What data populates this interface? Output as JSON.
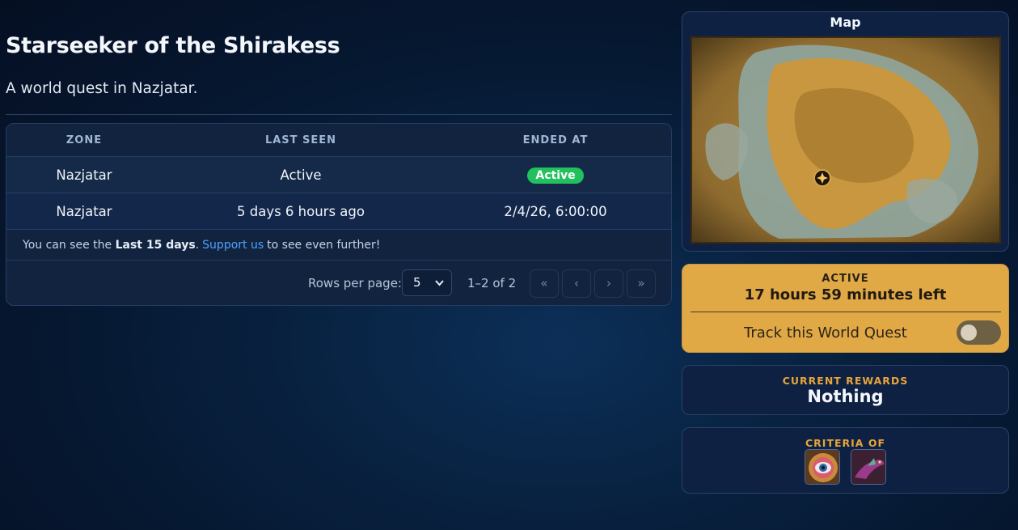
{
  "quest": {
    "title": "Starseeker of the Shirakess",
    "subtitle": "A world quest in Nazjatar."
  },
  "table": {
    "headers": [
      "ZONE",
      "LAST SEEN",
      "ENDED AT"
    ],
    "rows": [
      {
        "zone": "Nazjatar",
        "last_seen": "Active",
        "ended_at": "Active"
      },
      {
        "zone": "Nazjatar",
        "last_seen": "5 days 6 hours ago",
        "ended_at": "2/4/26, 6:00:00"
      }
    ],
    "note": {
      "prefix": "You can see the",
      "bold": "Last 15 days",
      "link": "Support us",
      "suffix": "to see even further!"
    },
    "pagination": {
      "rows_label": "Rows per page:",
      "rows_value": "5",
      "range": "1–2 of 2",
      "first": "«",
      "prev": "‹",
      "next": "›",
      "last": "»"
    }
  },
  "map": {
    "title": "Map",
    "marker_icon": "quest-marker-icon"
  },
  "status": {
    "label": "ACTIVE",
    "time_left": "17 hours 59 minutes left",
    "track_label": "Track this World Quest",
    "track_enabled": false
  },
  "rewards": {
    "label": "CURRENT REWARDS",
    "value": "Nothing"
  },
  "criteria": {
    "label": "CRITERIA OF",
    "icons": [
      "eye-achievement-icon",
      "eel-creature-icon"
    ]
  },
  "colors": {
    "accent": "#e0a946",
    "badge_active": "#22c15e",
    "link": "#4ea3ff",
    "label_orange": "#e6a53a"
  }
}
